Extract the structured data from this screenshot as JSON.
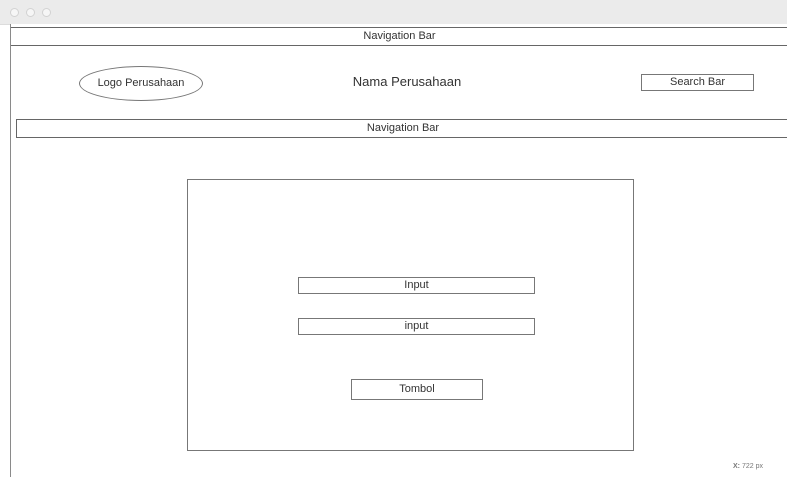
{
  "window": {
    "controls": [
      "close-dot",
      "minimize-dot",
      "zoom-dot"
    ]
  },
  "wireframe": {
    "top_nav_label": "Navigation Bar",
    "logo_label": "Logo Perusahaan",
    "company_name": "Nama Perusahaan",
    "search_label": "Search Bar",
    "second_nav_label": "Navigation Bar",
    "form": {
      "input1_label": "Input",
      "input2_label": "input",
      "button_label": "Tombol"
    }
  },
  "status": {
    "coord_label": "X:",
    "coord_value": "722 px"
  }
}
